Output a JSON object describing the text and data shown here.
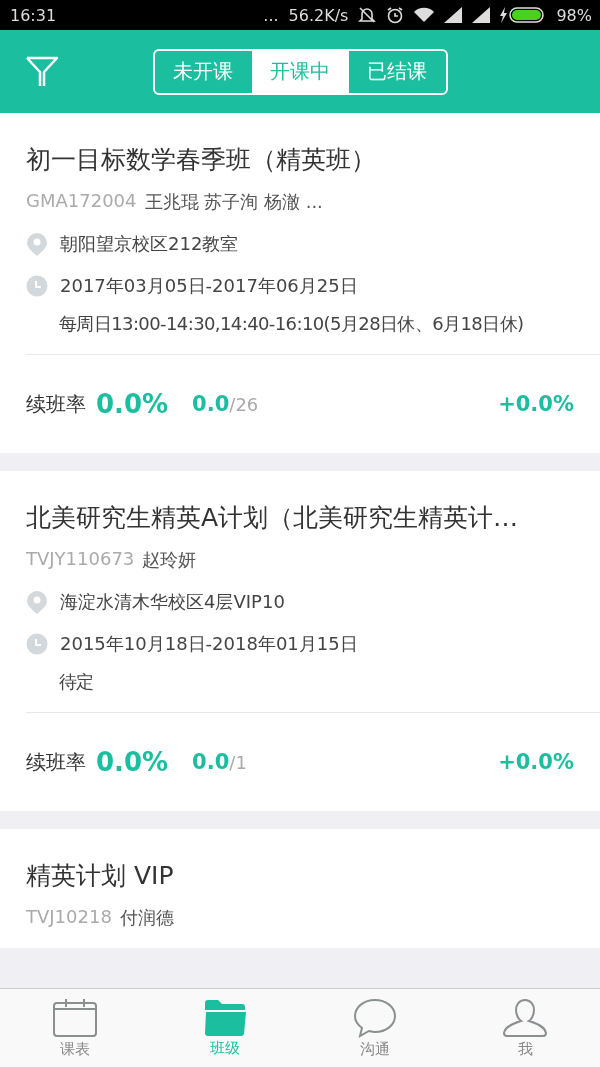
{
  "status_bar": {
    "time": "16:31",
    "dots": "...",
    "speed": "56.2K/s",
    "battery": "98%"
  },
  "header": {
    "tabs": [
      {
        "label": "未开课",
        "selected": false
      },
      {
        "label": "开课中",
        "selected": true
      },
      {
        "label": "已结课",
        "selected": false
      }
    ]
  },
  "classes": [
    {
      "title": "初一目标数学春季班（精英班）",
      "code": "GMA172004",
      "teachers": "王兆琨 苏子洵 杨澈 ...",
      "location": "朝阳望京校区212教室",
      "dates": "2017年03月05日-2017年06月25日",
      "schedule": "每周日13:00-14:30,14:40-16:10(5月28日休、6月18日休)",
      "stats": {
        "label": "续班率",
        "rate": "0.0%",
        "count": "0.0",
        "total": "/26",
        "change": "+0.0%"
      }
    },
    {
      "title": "北美研究生精英A计划（北美研究生精英计…",
      "code": "TVJY110673",
      "teachers": "赵玲妍",
      "location": "海淀水清木华校区4层VIP10",
      "dates": "2015年10月18日-2018年01月15日",
      "schedule": "待定",
      "stats": {
        "label": "续班率",
        "rate": "0.0%",
        "count": "0.0",
        "total": "/1",
        "change": "+0.0%"
      }
    },
    {
      "title": "精英计划 VIP",
      "code": "TVJ10218",
      "teachers": "付润德"
    }
  ],
  "tab_bar": [
    {
      "label": "课表",
      "selected": false,
      "kind": "calendar"
    },
    {
      "label": "班级",
      "selected": true,
      "kind": "folder"
    },
    {
      "label": "沟通",
      "selected": false,
      "kind": "chat"
    },
    {
      "label": "我",
      "selected": false,
      "kind": "person"
    }
  ]
}
